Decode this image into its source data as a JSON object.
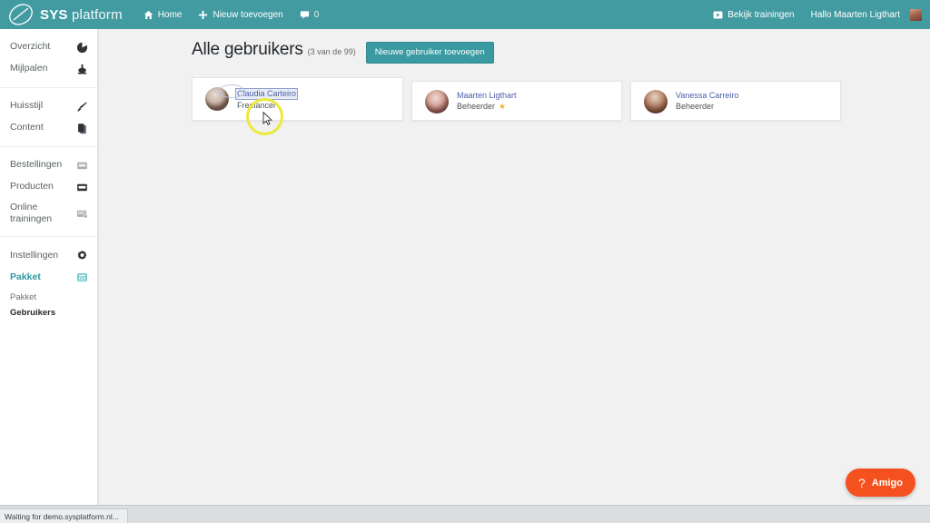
{
  "adminbar": {
    "brand_bold": "SYS",
    "brand_light": " platform",
    "home_label": "Home",
    "new_label": "Nieuw toevoegen",
    "comment_count": "0",
    "trainings_label": "Bekijk trainingen",
    "greeting": "Hallo Maarten Ligthart",
    "accent_color": "#439ba2"
  },
  "sidebar": {
    "groups": [
      {
        "items": [
          {
            "label": "Overzicht",
            "icon": "dashboard-icon",
            "active": false
          },
          {
            "label": "Mijlpalen",
            "icon": "milestone-icon",
            "active": false
          }
        ]
      },
      {
        "items": [
          {
            "label": "Huisstijl",
            "icon": "brush-icon",
            "active": false
          },
          {
            "label": "Content",
            "icon": "pages-icon",
            "active": false
          }
        ]
      },
      {
        "items": [
          {
            "label": "Bestellingen",
            "icon": "orders-icon",
            "active": false
          },
          {
            "label": "Producten",
            "icon": "products-icon",
            "active": false
          },
          {
            "label": "Online trainingen",
            "icon": "trainings-icon",
            "active": false
          }
        ]
      },
      {
        "items": [
          {
            "label": "Instellingen",
            "icon": "gear-icon",
            "active": false
          },
          {
            "label": "Pakket",
            "icon": "package-icon",
            "active": true
          }
        ]
      }
    ],
    "submenu": [
      {
        "label": "Pakket",
        "current": false
      },
      {
        "label": "Gebruikers",
        "current": true
      }
    ],
    "active_color": "#2e9aa1"
  },
  "page": {
    "title": "Alle gebruikers",
    "count": "(3 van de 99)",
    "add_button": "Nieuwe gebruiker toevoegen"
  },
  "users": [
    {
      "name": "Claudia Carteiro",
      "role": "Freelancer",
      "is_admin_star": false,
      "selected": true,
      "avatar": "avatar-claudia"
    },
    {
      "name": "Maarten Ligthart",
      "role": "Beheerder",
      "is_admin_star": true,
      "selected": false,
      "avatar": "avatar-maarten"
    },
    {
      "name": "Vanessa Carreiro",
      "role": "Beheerder",
      "is_admin_star": false,
      "selected": false,
      "avatar": "avatar-vanessa"
    }
  ],
  "star_glyph": "★",
  "amigo": {
    "question_mark": "?",
    "label": "Amigo",
    "color": "#f4511e"
  },
  "statusbar": {
    "text": "Waiting for demo.sysplatform.nl..."
  }
}
